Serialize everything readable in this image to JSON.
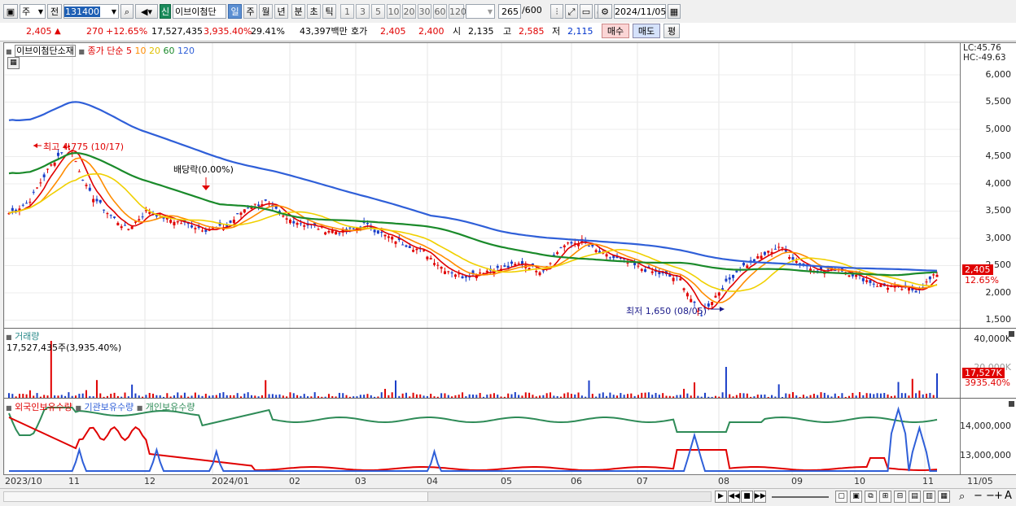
{
  "toolbar": {
    "market_sel": "주",
    "prev_label": "전",
    "code": "131400",
    "new_badge": "신",
    "stock_name": "이브이첨단",
    "periods": [
      "일",
      "주",
      "월",
      "년",
      "분",
      "초",
      "틱"
    ],
    "active_period": "일",
    "intervals": [
      "1",
      "3",
      "5",
      "10",
      "20",
      "30",
      "60",
      "120"
    ],
    "count": "265",
    "count_total": "/600",
    "date": "2024/11/05"
  },
  "infobar": {
    "price": "2,405",
    "change": "270",
    "change_pct": "+12.65%",
    "volume": "17,527,435",
    "vol_ratio": "3,935.40%",
    "turnover": "29.41%",
    "amount": "43,397백만",
    "quote_label": "호가",
    "ask": "2,405",
    "bid": "2,400",
    "open_label": "시",
    "open": "2,135",
    "high_label": "고",
    "high": "2,585",
    "low_label": "저",
    "low": "2,115",
    "buy_btn": "매수",
    "sell_btn": "매도",
    "eval_btn": "평"
  },
  "price_panel": {
    "legend_name": "이브이첨단소재",
    "legend_ma": "종가 단순",
    "ma_periods": [
      "5",
      "10",
      "20",
      "60",
      "120"
    ],
    "ma_colors": [
      "#e00000",
      "#ff8c00",
      "#f0d000",
      "#1a8a2a",
      "#2f5fd8"
    ],
    "yticks": [
      "6,000",
      "5,500",
      "5,000",
      "4,500",
      "4,000",
      "3,500",
      "3,000",
      "2,500",
      "2,000",
      "1,500"
    ],
    "lc": "LC:45.76",
    "hc": "HC:-49.63",
    "last_price_tag": "2,405",
    "last_pct_tag": "12.65%",
    "high_annot": "최고 4,775 (10/17)",
    "div_annot": "배당락(0.00%)",
    "low_annot": "최저 1,650 (08/05)"
  },
  "volume_panel": {
    "title": "거래량",
    "value_text": "17,527,435주(3,935.40%)",
    "yticks": [
      "40,000K",
      "20,000K"
    ],
    "last_tag": "17,527K",
    "last_pct": "3935.40%"
  },
  "holding_panel": {
    "legends": [
      "외국인보유수량",
      "기관보유수량",
      "개인보유수량"
    ],
    "colors": [
      "#e00000",
      "#2f5fd8",
      "#2e8b57"
    ],
    "yticks": [
      "14,000,000",
      "13,000,000"
    ]
  },
  "x_labels": [
    "2023/10",
    "11",
    "12",
    "2024/01",
    "02",
    "03",
    "04",
    "05",
    "06",
    "07",
    "08",
    "09",
    "10",
    "11",
    "11/05"
  ],
  "chart_data": {
    "type": "line",
    "x_range": [
      "2023/10",
      "2024/11/05"
    ],
    "ylim_price": [
      1500,
      6200
    ],
    "close_series_approx": [
      3500,
      3700,
      4300,
      4775,
      3900,
      3500,
      3200,
      3550,
      3400,
      3300,
      3200,
      3250,
      3600,
      3700,
      3400,
      3300,
      3200,
      3150,
      3300,
      3100,
      2950,
      2800,
      2500,
      2350,
      2450,
      2500,
      2600,
      2450,
      2900,
      3000,
      2750,
      2650,
      2500,
      2400,
      2300,
      1650,
      2100,
      2500,
      2700,
      2900,
      2600,
      2450,
      2500,
      2350,
      2200,
      2150,
      2100,
      2405
    ],
    "series": [
      {
        "name": "5",
        "values": []
      },
      {
        "name": "120",
        "values": []
      }
    ]
  }
}
